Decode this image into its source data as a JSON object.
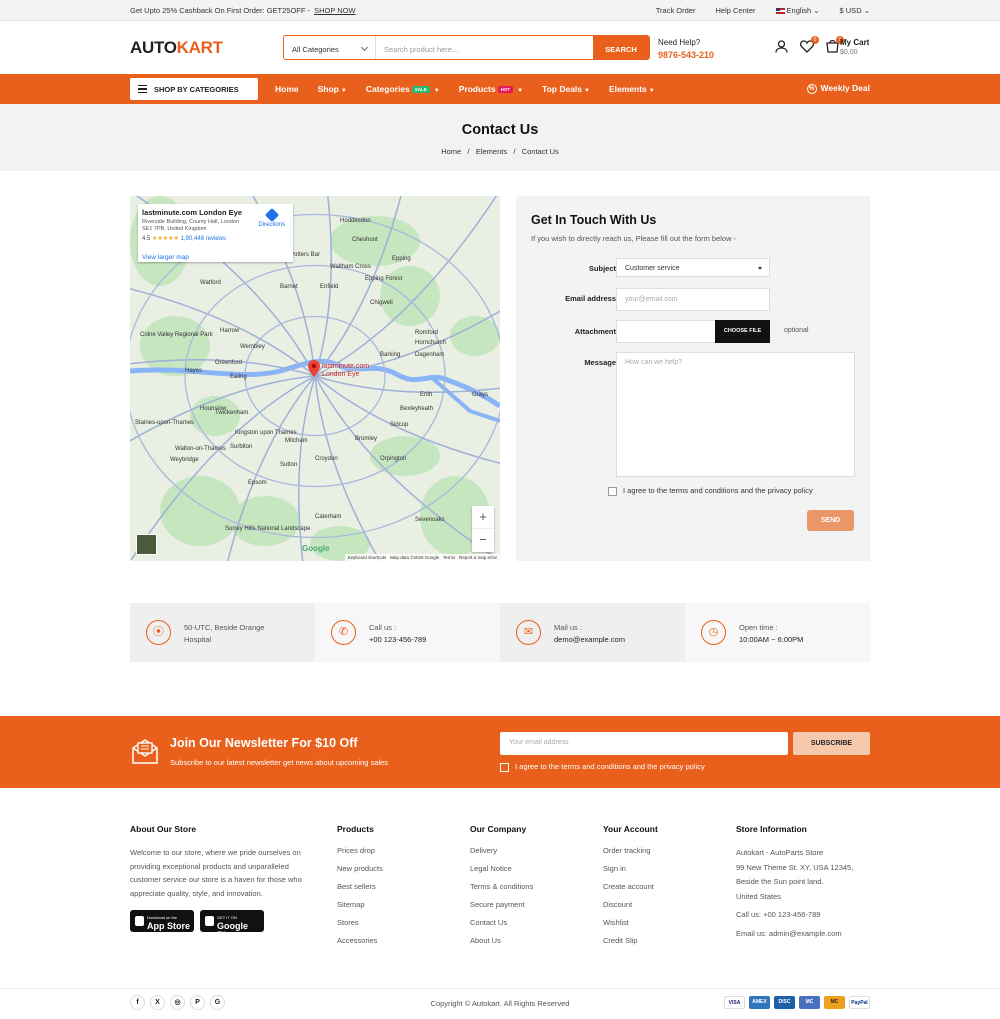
{
  "topbar": {
    "promo": "Get Upto 25% Cashback On First Order: GET25OFF -",
    "shop_now": "SHOP NOW",
    "track_order": "Track Order",
    "help_center": "Help Center",
    "language": "English",
    "currency": "$ USD"
  },
  "header": {
    "logo_a": "AUTO",
    "logo_b": "KART",
    "search_category": "All Categories",
    "search_placeholder": "Search product here...",
    "search_button": "SEARCH",
    "need_help": "Need Help?",
    "phone": "9876-543-210",
    "wishlist_count": "0",
    "cart_count": "0",
    "cart_title": "My Cart",
    "cart_total": "$0.00"
  },
  "nav": {
    "shop_by_categories": "SHOP BY CATEGORIES",
    "items": [
      {
        "label": "Home"
      },
      {
        "label": "Shop"
      },
      {
        "label": "Categories",
        "tag": "SALE"
      },
      {
        "label": "Products",
        "tag": "HOT"
      },
      {
        "label": "Top Deals"
      },
      {
        "label": "Elements"
      }
    ],
    "weekly_deal": "Weekly Deal",
    "colors": {
      "accent": "#e8601c",
      "sale": "#2bb673",
      "hot": "#e8155b"
    }
  },
  "page_title": {
    "title": "Contact Us",
    "breadcrumb": [
      "Home",
      "Elements",
      "Contact Us"
    ]
  },
  "map": {
    "place_name": "lastminute.com London Eye",
    "address": "Riverside Building, County Hall, London SE1 7PB, United Kingdom",
    "rating": "4.5",
    "stars": "★★★★★",
    "reviews": "1,90,448 reviews",
    "directions": "Directions",
    "view_larger": "View larger map",
    "pin_label": "lastminute.com London Eye",
    "google": "Google",
    "footer": [
      "Keyboard shortcuts",
      "Map data ©2025 Google",
      "Terms",
      "Report a map error"
    ],
    "places": [
      "Hoddesdon",
      "Potters Bar",
      "Cheshunt",
      "Waltham Cross",
      "Epping",
      "Watford",
      "Barnet",
      "Enfield",
      "Epping Forest",
      "Chigwell",
      "Colne Valley Regional Park",
      "Harrow",
      "Wembley",
      "Romford",
      "Hornchurch",
      "Greenford",
      "Barking",
      "Dagenham",
      "Hayes",
      "Ealing",
      "Erith",
      "Bexleyheath",
      "Hounslow",
      "Twickenham",
      "Staines-upon-Thames",
      "Kingston upon Thames",
      "Surbiton",
      "Mitcham",
      "Bromley",
      "Sidcup",
      "Walton-on-Thames",
      "Weybridge",
      "Sutton",
      "Croydon",
      "Orpington",
      "Epsom",
      "Caterham",
      "Sevenoaks",
      "Surrey Hills National Landscape",
      "Grays"
    ]
  },
  "form": {
    "title": "Get In Touch With Us",
    "subtitle": "If you wish to directly reach us, Please fill out the form below -",
    "subject_label": "Subject",
    "subject_value": "Customer service",
    "email_label": "Email address",
    "email_placeholder": "your@email.com",
    "attachment_label": "Attachment",
    "choose_file": "CHOOSE FILE",
    "optional": "optional",
    "message_label": "Message",
    "message_placeholder": "How can we help?",
    "agree": "I agree to the terms and conditions and the privacy policy",
    "send": "SEND"
  },
  "info": [
    {
      "icon": "location-pin-icon",
      "l1": "50-UTC, Beside Orange",
      "l2": "Hospital"
    },
    {
      "icon": "phone-icon",
      "l1": "Call us :",
      "l2": "+00 123-456-789"
    },
    {
      "icon": "mail-icon",
      "l1": "Mail us :",
      "l2": "demo@example.com"
    },
    {
      "icon": "clock-icon",
      "l1": "Open time :",
      "l2": "10:00AM ~ 6:00PM"
    }
  ],
  "newsletter": {
    "title": "Join Our Newsletter For $10 Off",
    "subtitle": "Subscribe to our latest newsletter get news about upcoming sales",
    "placeholder": "Your email address",
    "button": "SUBSCRIBE",
    "agree": "I agree to the terms and conditions and the privacy policy"
  },
  "footer": {
    "about_title": "About Our Store",
    "about_text": "Welcome to our store, where we pride ourselves on providing exceptional products and unparalleled customer service our store is a haven for those who appreciate quality, style, and innovation.",
    "app_store_small": "Download on the",
    "app_store": "App Store",
    "google_play_small": "GET IT ON",
    "google_play": "Google Play",
    "products_title": "Products",
    "products": [
      "Prices drop",
      "New products",
      "Best sellers",
      "Sitemap",
      "Stores",
      "Accessories"
    ],
    "company_title": "Our Company",
    "company": [
      "Delivery",
      "Legal Notice",
      "Terms & conditions",
      "Secure payment",
      "Contact Us",
      "About Us"
    ],
    "account_title": "Your Account",
    "account": [
      "Order tracking",
      "Sign in",
      "Create account",
      "Discount",
      "Wishlist",
      "Credit Slip"
    ],
    "store_title": "Store Information",
    "store_lines": [
      "Autokart - AutoParts Store",
      "99 New Theme St. XY, USA 12345,",
      "Beside the Sun point land.",
      "United States"
    ],
    "store_call": "Call us: +00 123-456-789",
    "store_email": "Email us: admin@example.com",
    "social": [
      "f",
      "X",
      "◎",
      "P",
      "G"
    ],
    "copyright": "Copyright © Autokart. All Rights Reserved",
    "payments": [
      "VISA",
      "AMEX",
      "DISC",
      "MC",
      "MC",
      "PayPal"
    ]
  }
}
